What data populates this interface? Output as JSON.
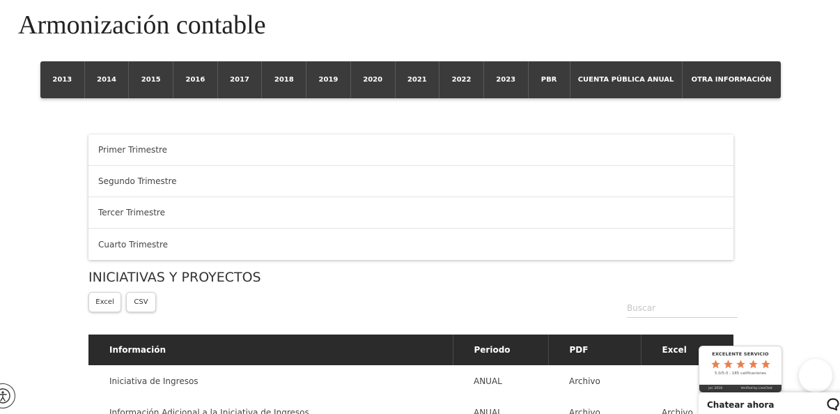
{
  "page": {
    "title": "Armonización contable"
  },
  "year_nav": {
    "tabs": [
      "2013",
      "2014",
      "2015",
      "2016",
      "2017",
      "2018",
      "2019",
      "2020",
      "2021",
      "2022",
      "2023"
    ],
    "pbr": "PBR",
    "cuenta_publica": "CUENTA PÚBLICA ANUAL",
    "otra_informacion": "OTRA INFORMACIÓN"
  },
  "quarters": [
    "Primer Trimestre",
    "Segundo Trimestre",
    "Tercer Trimestre",
    "Cuarto Trimestre"
  ],
  "section": {
    "title": "INICIATIVAS Y PROYECTOS"
  },
  "export": {
    "excel": "Excel",
    "csv": "CSV"
  },
  "search": {
    "placeholder": "Buscar",
    "value": ""
  },
  "table": {
    "headers": [
      "Información",
      "Periodo",
      "PDF",
      "Excel"
    ],
    "rows": [
      {
        "info": "Iniciativa de Ingresos",
        "periodo": "ANUAL",
        "pdf": "Archivo",
        "excel": ""
      },
      {
        "info": "Información Adicional a la Iniciativa de Ingresos",
        "periodo": "ANUAL",
        "pdf": "Archivo",
        "excel": "Archivo"
      }
    ]
  },
  "rating_badge": {
    "title": "EXCELENTE SERVICIO",
    "score": "5.0/5.0 - 185 calificaciones",
    "footer_date": "Jul. 2018",
    "footer_verified": "Verified by LiveChat",
    "stars": 5,
    "star_color": "#e8804e"
  },
  "chat": {
    "label": "Chatear ahora"
  },
  "colors": {
    "nav_bg": "#3b3b3b",
    "table_header_bg": "#2b2b2b"
  }
}
